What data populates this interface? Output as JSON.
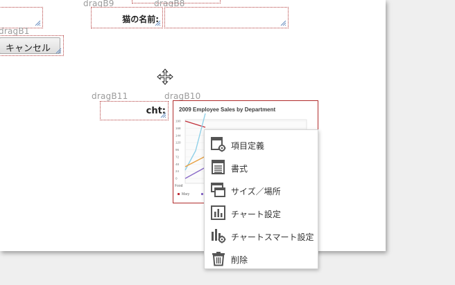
{
  "designer": {
    "labels": {
      "b9": "dragB9",
      "b8": "dragB8",
      "b1": "dragB1",
      "b11": "dragB11",
      "b10": "dragB10"
    },
    "cat_name_label": "猫の名前:",
    "cancel_button": "キャンセル",
    "cht_label": "cht:"
  },
  "chart_data": {
    "type": "line",
    "title": "2009 Employee Sales by Department",
    "y_ticks": [
      "190",
      "168",
      "144",
      "120",
      "96",
      "72",
      "48",
      "24",
      "0"
    ],
    "x_ticks": [
      "Food"
    ],
    "legend": [
      "Mary"
    ],
    "series_colors": [
      "#c0303a",
      "#8fd0e8",
      "#e8a040",
      "#8a6ac8"
    ]
  },
  "context_menu": {
    "items": [
      {
        "label": "項目定義",
        "icon": "field-definition-icon"
      },
      {
        "label": "書式",
        "icon": "format-icon"
      },
      {
        "label": "サイズ／場所",
        "icon": "size-position-icon"
      },
      {
        "label": "チャート設定",
        "icon": "chart-settings-icon"
      },
      {
        "label": "チャートスマート設定",
        "icon": "chart-smart-settings-icon"
      },
      {
        "label": "削除",
        "icon": "trash-icon"
      }
    ]
  }
}
